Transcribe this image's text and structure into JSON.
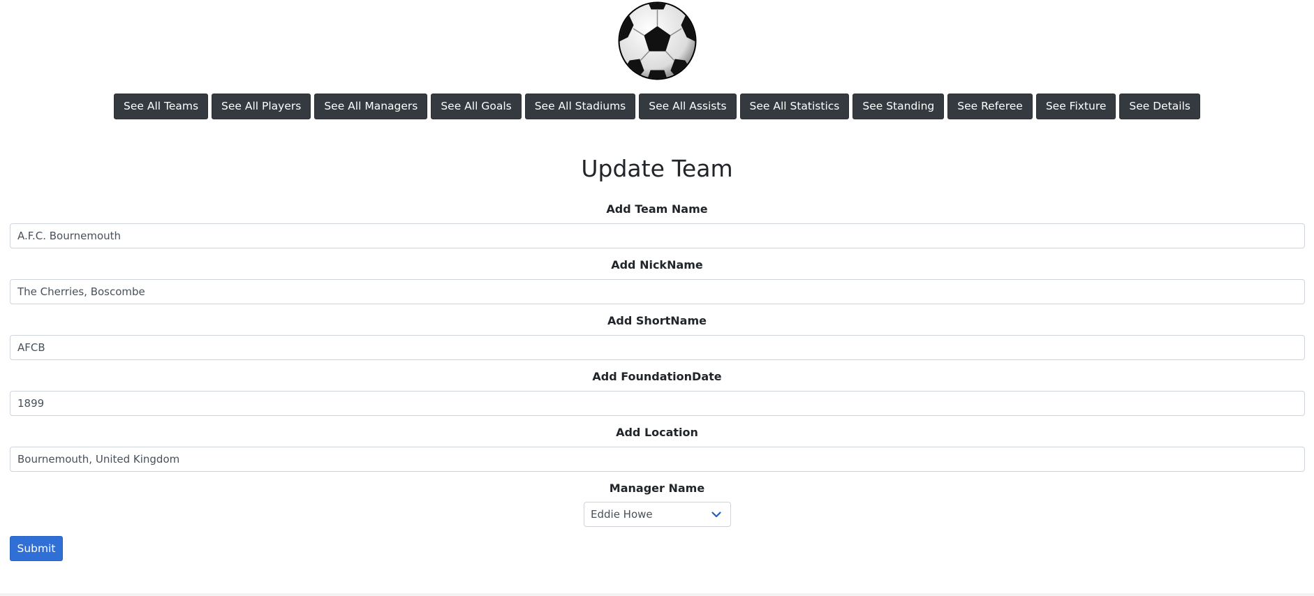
{
  "logo": {
    "icon": "soccer-ball-icon"
  },
  "nav": {
    "buttons": [
      "See All Teams",
      "See All Players",
      "See All Managers",
      "See All Goals",
      "See All Stadiums",
      "See All Assists",
      "See All Statistics",
      "See Standing",
      "See Referee",
      "See Fixture",
      "See Details"
    ]
  },
  "form": {
    "title": "Update Team",
    "team_name": {
      "label": "Add Team Name",
      "value": "A.F.C. Bournemouth"
    },
    "nickname": {
      "label": "Add NickName",
      "value": "The Cherries, Boscombe"
    },
    "shortname": {
      "label": "Add ShortName",
      "value": "AFCB"
    },
    "foundation_date": {
      "label": "Add FoundationDate",
      "value": "1899"
    },
    "location": {
      "label": "Add Location",
      "value": "Bournemouth, United Kingdom"
    },
    "manager": {
      "label": "Manager Name",
      "selected": "Eddie Howe"
    },
    "submit_label": "Submit"
  },
  "colors": {
    "nav_button_bg": "#343a40",
    "primary": "#2f6fd6",
    "chevron": "#1f5fbf"
  }
}
